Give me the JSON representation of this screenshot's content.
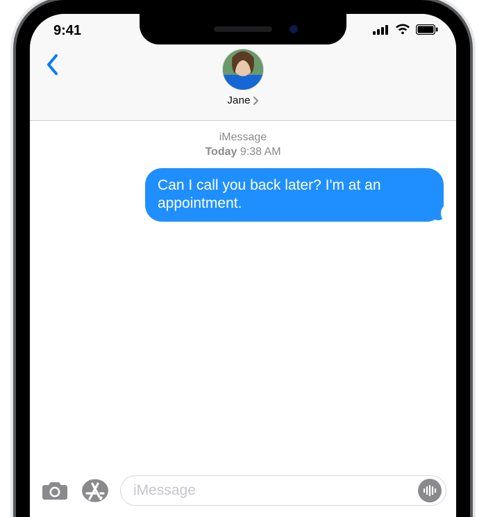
{
  "statusbar": {
    "time": "9:41"
  },
  "header": {
    "contact_name": "Jane"
  },
  "thread": {
    "service_label": "iMessage",
    "timestamp_day": "Today",
    "timestamp_time": "9:38 AM",
    "messages": [
      {
        "from": "me",
        "text": "Can I call you back later? I'm at an appointment."
      }
    ]
  },
  "compose": {
    "placeholder": "iMessage"
  },
  "colors": {
    "ios_blue": "#007aff",
    "bubble_blue": "#1f8fff"
  }
}
